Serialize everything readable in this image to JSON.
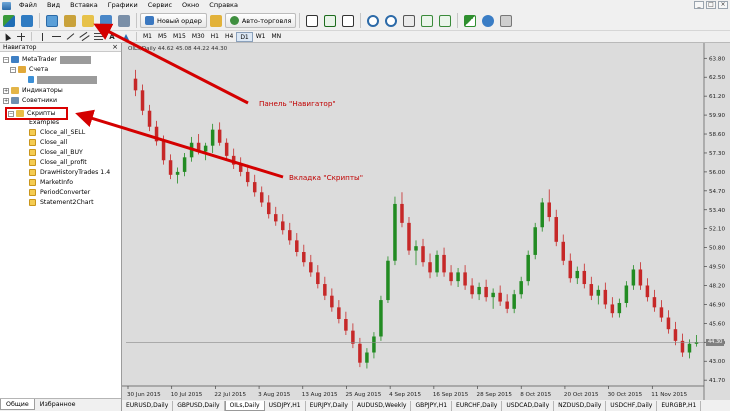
{
  "menu": {
    "items": [
      "Файл",
      "Вид",
      "Вставка",
      "Графики",
      "Сервис",
      "Окно",
      "Справка"
    ]
  },
  "window_controls": [
    "_",
    "□",
    "×"
  ],
  "toolbar": {
    "new_order": "Новый ордер",
    "auto_trading": "Авто-торговля",
    "timeframes": [
      "M1",
      "M5",
      "M15",
      "M30",
      "H1",
      "H4",
      "D1",
      "W1",
      "MN"
    ],
    "active_timeframe": "D1"
  },
  "navigator": {
    "title": "Навигатор",
    "close": "×",
    "root": "MetaTrader",
    "accounts": "Счета",
    "indicators": "Индикаторы",
    "advisors": "Советники",
    "scripts": "Скрипты",
    "script_items": [
      "Examples",
      "Cloce_all_SELL",
      "Close_all",
      "Close_all_BUY",
      "Close_all_profit",
      "DrawHistoryTrades 1.4",
      "MarketInfo",
      "PeriodConverter",
      "Statement2Chart"
    ],
    "tabs": [
      "Общие",
      "Избранное"
    ]
  },
  "annotations": {
    "navigator_panel": "Панель \"Навигатор\"",
    "scripts_tab": "Вкладка \"Скрипты\""
  },
  "chart_tabs": [
    "EURUSD,Daily",
    "GBPUSD,Daily",
    "OILs,Daily",
    "USDJPY,H1",
    "EURJPY,Daily",
    "AUDUSD,Weekly",
    "GBPJPY,H1",
    "EURCHF,Daily",
    "USDCAD,Daily",
    "NZDUSD,Daily",
    "USDCHF,Daily",
    "EURGBP,H1"
  ],
  "chart_data": {
    "type": "candlestick",
    "info_line": "OILs,Daily  44.62 45.08 44.22 44.30",
    "price_label": "44.30",
    "y_ticks": [
      "63.80",
      "62.50",
      "61.20",
      "59.90",
      "58.60",
      "57.30",
      "56.00",
      "54.70",
      "53.40",
      "52.10",
      "50.80",
      "49.50",
      "48.20",
      "46.90",
      "45.60",
      "44.30",
      "43.00",
      "41.70"
    ],
    "y_range": [
      41.3,
      64.3
    ],
    "x_ticks": [
      "30 Jun 2015",
      "10 Jul 2015",
      "22 Jul 2015",
      "3 Aug 2015",
      "13 Aug 2015",
      "25 Aug 2015",
      "4 Sep 2015",
      "16 Sep 2015",
      "28 Sep 2015",
      "8 Oct 2015",
      "20 Oct 2015",
      "30 Oct 2015",
      "11 Nov 2015"
    ],
    "colors": {
      "bull": "#228b22",
      "bear": "#c62828",
      "background": "#dcdcdc"
    },
    "candles": [
      [
        62.4,
        63.0,
        61.2,
        61.6
      ],
      [
        61.6,
        62.0,
        59.9,
        60.2
      ],
      [
        60.2,
        60.6,
        58.8,
        59.1
      ],
      [
        59.1,
        59.5,
        57.8,
        58.1
      ],
      [
        58.1,
        58.5,
        56.5,
        56.8
      ],
      [
        56.8,
        57.2,
        55.5,
        55.8
      ],
      [
        55.8,
        56.3,
        55.2,
        56.0
      ],
      [
        56.0,
        57.3,
        55.7,
        57.0
      ],
      [
        57.0,
        58.4,
        56.7,
        58.0
      ],
      [
        58.0,
        58.6,
        57.2,
        57.4
      ],
      [
        57.4,
        58.0,
        56.8,
        57.8
      ],
      [
        57.8,
        59.3,
        57.3,
        58.9
      ],
      [
        58.9,
        59.4,
        57.8,
        58.0
      ],
      [
        58.0,
        58.3,
        56.8,
        57.1
      ],
      [
        57.1,
        57.6,
        56.2,
        56.5
      ],
      [
        56.5,
        57.0,
        55.7,
        56.0
      ],
      [
        56.0,
        56.5,
        55.0,
        55.3
      ],
      [
        55.3,
        55.8,
        54.3,
        54.6
      ],
      [
        54.6,
        55.0,
        53.6,
        53.9
      ],
      [
        53.9,
        54.4,
        52.8,
        53.1
      ],
      [
        53.1,
        53.6,
        52.3,
        52.6
      ],
      [
        52.6,
        53.1,
        51.7,
        52.0
      ],
      [
        52.0,
        52.5,
        51.0,
        51.3
      ],
      [
        51.3,
        51.8,
        50.2,
        50.5
      ],
      [
        50.5,
        51.0,
        49.5,
        49.8
      ],
      [
        49.8,
        50.3,
        48.8,
        49.1
      ],
      [
        49.1,
        49.6,
        48.0,
        48.3
      ],
      [
        48.3,
        48.8,
        47.2,
        47.5
      ],
      [
        47.5,
        48.0,
        46.4,
        46.7
      ],
      [
        46.7,
        47.2,
        45.6,
        45.9
      ],
      [
        45.9,
        46.4,
        44.8,
        45.1
      ],
      [
        45.1,
        45.6,
        43.9,
        44.2
      ],
      [
        44.2,
        44.6,
        42.6,
        42.9
      ],
      [
        42.9,
        43.9,
        42.5,
        43.6
      ],
      [
        43.6,
        45.0,
        43.2,
        44.7
      ],
      [
        44.7,
        47.5,
        44.4,
        47.2
      ],
      [
        47.2,
        50.2,
        47.0,
        49.9
      ],
      [
        49.9,
        54.3,
        49.6,
        53.8
      ],
      [
        53.8,
        54.6,
        52.2,
        52.5
      ],
      [
        52.5,
        52.9,
        50.3,
        50.6
      ],
      [
        50.6,
        51.3,
        49.6,
        50.9
      ],
      [
        50.9,
        51.4,
        49.5,
        49.8
      ],
      [
        49.8,
        50.4,
        48.7,
        49.1
      ],
      [
        49.1,
        50.6,
        48.8,
        50.3
      ],
      [
        50.3,
        50.8,
        48.8,
        49.1
      ],
      [
        49.1,
        49.6,
        48.2,
        48.5
      ],
      [
        48.5,
        49.4,
        48.1,
        49.1
      ],
      [
        49.1,
        49.6,
        47.9,
        48.2
      ],
      [
        48.2,
        48.7,
        47.3,
        47.6
      ],
      [
        47.6,
        48.4,
        47.2,
        48.1
      ],
      [
        48.1,
        48.6,
        47.1,
        47.4
      ],
      [
        47.4,
        48.0,
        46.6,
        47.7
      ],
      [
        47.7,
        48.2,
        46.8,
        47.1
      ],
      [
        47.1,
        47.6,
        46.3,
        46.6
      ],
      [
        46.6,
        47.9,
        46.3,
        47.6
      ],
      [
        47.6,
        48.8,
        47.3,
        48.5
      ],
      [
        48.5,
        50.6,
        48.2,
        50.3
      ],
      [
        50.3,
        52.5,
        50.0,
        52.2
      ],
      [
        52.2,
        54.2,
        51.9,
        53.9
      ],
      [
        53.9,
        54.8,
        52.6,
        52.9
      ],
      [
        52.9,
        53.4,
        50.9,
        51.2
      ],
      [
        51.2,
        51.7,
        49.6,
        49.9
      ],
      [
        49.9,
        50.4,
        48.4,
        48.7
      ],
      [
        48.7,
        49.5,
        48.3,
        49.2
      ],
      [
        49.2,
        49.7,
        48.0,
        48.3
      ],
      [
        48.3,
        48.8,
        47.2,
        47.5
      ],
      [
        47.5,
        48.2,
        46.9,
        47.9
      ],
      [
        47.9,
        48.4,
        46.6,
        46.9
      ],
      [
        46.9,
        47.4,
        46.0,
        46.3
      ],
      [
        46.3,
        47.3,
        46.0,
        47.0
      ],
      [
        47.0,
        48.5,
        46.7,
        48.2
      ],
      [
        48.2,
        49.6,
        47.9,
        49.3
      ],
      [
        49.3,
        49.8,
        47.9,
        48.2
      ],
      [
        48.2,
        48.7,
        47.1,
        47.4
      ],
      [
        47.4,
        47.9,
        46.4,
        46.7
      ],
      [
        46.7,
        47.2,
        45.7,
        46.0
      ],
      [
        46.0,
        46.5,
        44.9,
        45.2
      ],
      [
        45.2,
        45.7,
        44.1,
        44.4
      ],
      [
        44.4,
        44.9,
        43.3,
        43.6
      ],
      [
        43.6,
        44.5,
        43.2,
        44.2
      ],
      [
        44.2,
        44.8,
        44.0,
        44.3
      ]
    ]
  }
}
